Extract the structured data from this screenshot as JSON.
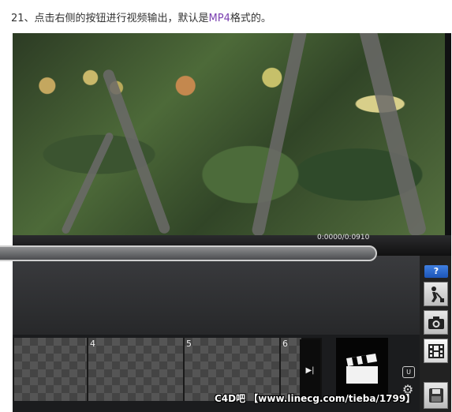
{
  "caption": {
    "prefix": "21、点击右侧的按钮进行视频输出，默认是",
    "highlight": "MP4",
    "suffix": "格式的。"
  },
  "player": {
    "timecode": "0:0000/0:0910",
    "frames": [
      {
        "number": ""
      },
      {
        "number": "4"
      },
      {
        "number": "5"
      },
      {
        "number": "6"
      }
    ],
    "next_label": "▶|",
    "u_label": "U",
    "help_label": "?"
  },
  "toolbar": {
    "icons": [
      "shovel-icon",
      "camera-icon",
      "film-icon",
      "save-icon"
    ]
  },
  "watermark": "C4D吧 【www.linecg.com/tieba/1799】",
  "colors": {
    "caption_highlight": "#7a3fb0",
    "help_blue": "#2f6fd6",
    "app_bg": "#1b1c1e"
  }
}
